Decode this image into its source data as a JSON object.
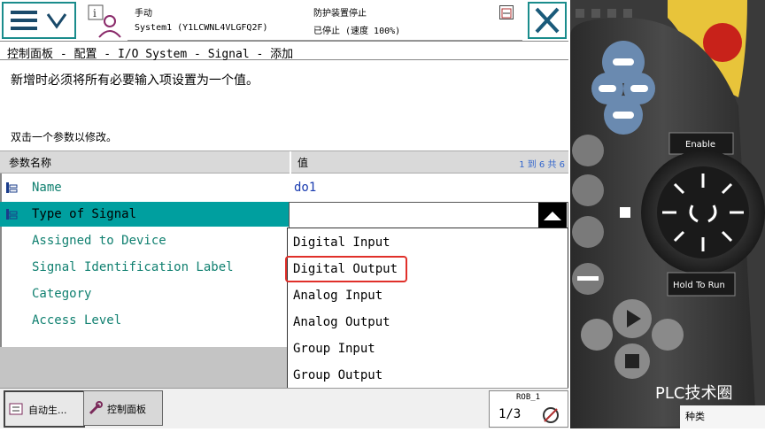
{
  "header": {
    "mode": "手动",
    "system": "System1 (Y1LCWNL4VLGFQ2F)",
    "safety": "防护装置停止",
    "state": "已停止 (速度 100%)"
  },
  "breadcrumb": "控制面板 - 配置 - I/O System - Signal - 添加",
  "instruction": "新增时必须将所有必要输入项设置为一个值。",
  "hint": "双击一个参数以修改。",
  "table": {
    "col_name": "参数名称",
    "col_value": "值",
    "count": "1 到 6 共 6",
    "rows": [
      {
        "name": "Name",
        "value": "do1"
      },
      {
        "name": "Type of Signal",
        "value": ""
      },
      {
        "name": "Assigned to Device"
      },
      {
        "name": "Signal Identification Label"
      },
      {
        "name": "Category"
      },
      {
        "name": "Access Level"
      }
    ]
  },
  "dropdown": {
    "options": [
      "Digital Input",
      "Digital Output",
      "Analog Input",
      "Analog Output",
      "Group Input",
      "Group Output"
    ],
    "highlighted": "Digital Output"
  },
  "taskbar": {
    "btn1": "自动生...",
    "btn2": "控制面板",
    "rob": "ROB_1",
    "fraction": "1/3"
  },
  "pendant": {
    "enable": "Enable",
    "hold": "Hold To Run",
    "watermark": "PLC技术圈",
    "bottom_text": "种类"
  },
  "colors": {
    "teal": "#009f9f",
    "name_green": "#108070",
    "value_blue": "#1a3cb0",
    "highlight_red": "#e0302a"
  }
}
